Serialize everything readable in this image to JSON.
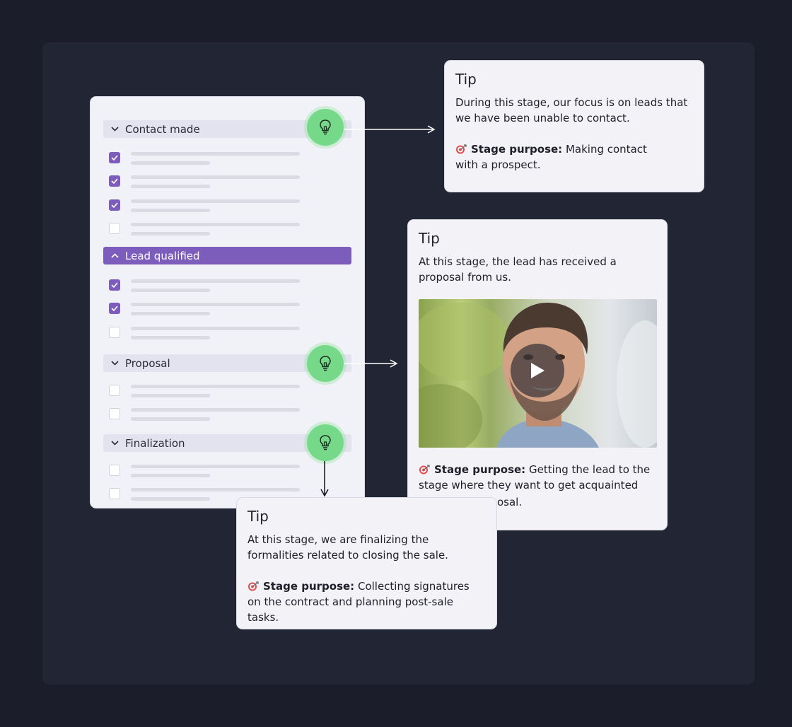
{
  "stages": [
    {
      "label": "Contact made",
      "expanded": false,
      "tasks": [
        true,
        true,
        true,
        false
      ]
    },
    {
      "label": "Lead qualified",
      "expanded": true,
      "tasks": [
        true,
        true,
        false
      ]
    },
    {
      "label": "Proposal",
      "expanded": false,
      "tasks": [
        false,
        false
      ]
    },
    {
      "label": "Finalization",
      "expanded": false,
      "tasks": [
        false,
        false
      ]
    }
  ],
  "tips": {
    "contact": {
      "title": "Tip",
      "text": "During this stage, our focus is on leads that we have been unable to contact.",
      "purpose_label": "Stage purpose:",
      "purpose_text": "Making contact with a prospect."
    },
    "proposal": {
      "title": "Tip",
      "text": "At this stage, the lead has received a proposal from us.",
      "purpose_label": "Stage purpose:",
      "purpose_text": "Getting the lead to the stage where they want to get acquainted",
      "purpose_tail": "osal."
    },
    "finalization": {
      "title": "Tip",
      "text": "At this stage, we are finalizing the formalities related to closing the sale.",
      "purpose_label": "Stage purpose:",
      "purpose_text": "Collecting signatures on the contract and planning post-sale tasks."
    }
  },
  "icons": {
    "bulb": "lightbulb-icon",
    "play": "play-icon",
    "target": "target-icon",
    "check": "checkmark-icon",
    "chevron_down": "chevron-down-icon",
    "chevron_up": "chevron-up-icon"
  },
  "colors": {
    "accent": "#7d5dbb",
    "bulb": "#76d98a",
    "background": "#1b1e2a"
  }
}
